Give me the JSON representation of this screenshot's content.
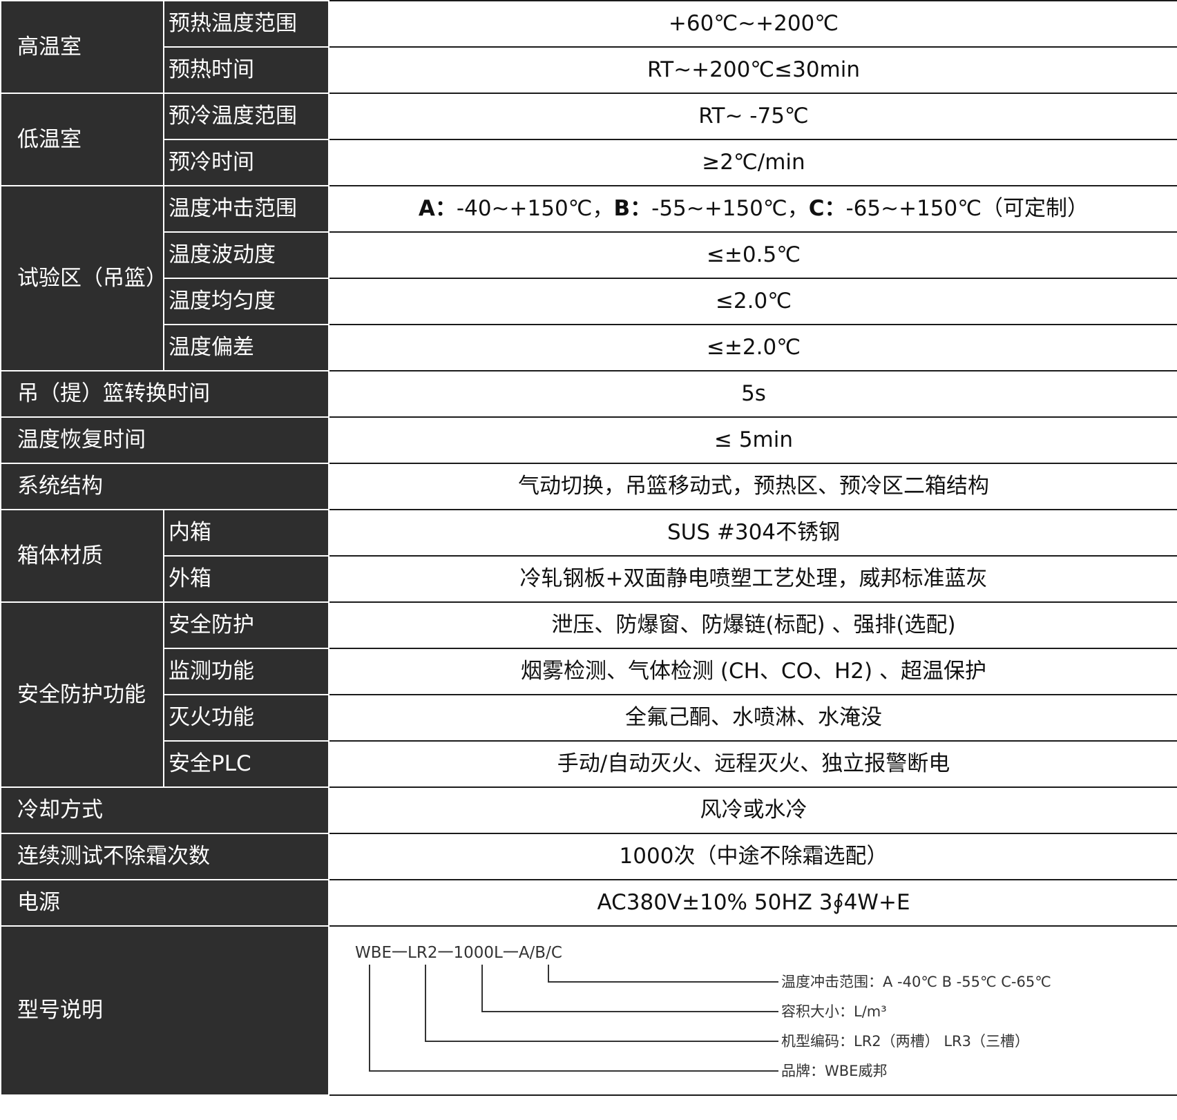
{
  "rows": {
    "high_temp": {
      "header": "高温室",
      "preheat_range": {
        "label": "预热温度范围",
        "value": "+60℃~+200℃"
      },
      "preheat_time": {
        "label": "预热时间",
        "value": "RT~+200℃≤30min"
      }
    },
    "low_temp": {
      "header": "低温室",
      "precool_range": {
        "label": "预冷温度范围",
        "value": "RT~ -75℃"
      },
      "precool_time": {
        "label": "预冷时间",
        "value": "≥2℃/min"
      }
    },
    "test_zone": {
      "header": "试验区（吊篮）",
      "shock_range": {
        "label": "温度冲击范围",
        "a_key": "A：",
        "a_val": "-40~+150℃，",
        "b_key": "B：",
        "b_val": "-55~+150℃，",
        "c_key": "C：",
        "c_val": "-65~+150℃（可定制）"
      },
      "fluctuation": {
        "label": "温度波动度",
        "value": "≤±0.5℃"
      },
      "uniformity": {
        "label": "温度均匀度",
        "value": "≤2.0℃"
      },
      "deviation": {
        "label": "温度偏差",
        "value": "≤±2.0℃"
      }
    },
    "basket_switch": {
      "header": "吊（提）篮转换时间",
      "value": "5s"
    },
    "recovery": {
      "header": "温度恢复时间",
      "value": "≤ 5min"
    },
    "structure": {
      "header": "系统结构",
      "value": "气动切换，吊篮移动式，预热区、预冷区二箱结构"
    },
    "material": {
      "header": "箱体材质",
      "inner": {
        "label": "内箱",
        "value": "SUS #304不锈钢"
      },
      "outer": {
        "label": "外箱",
        "value": "冷轧钢板+双面静电喷塑工艺处理，威邦标准蓝灰"
      }
    },
    "safety": {
      "header": "安全防护功能",
      "protection": {
        "label": "安全防护",
        "value": "泄压、防爆窗、防爆链(标配) 、强排(选配)"
      },
      "monitoring": {
        "label": "监测功能",
        "value": "烟雾检测、气体检测 (CH、CO、H2) 、超温保护"
      },
      "extinguish": {
        "label": "灭火功能",
        "value": "全氟己酮、水喷淋、水淹没"
      },
      "plc": {
        "label": "安全PLC",
        "value": "手动/自动灭火、远程灭火、独立报警断电"
      }
    },
    "cooling": {
      "header": "冷却方式",
      "value": "风冷或水冷"
    },
    "cycles": {
      "header": "连续测试不除霜次数",
      "value": "1000次（中途不除霜选配）"
    },
    "power": {
      "header": "电源",
      "value": "AC380V±10% 50HZ 3∮4W+E"
    },
    "model": {
      "header": "型号说明",
      "code": "WBE一LR2一1000L一A/B/C",
      "notes": {
        "range": "温度冲击范围：A -40℃  B -55℃  C-65℃",
        "volume": "容积大小：L/m³",
        "machine": "机型编码：LR2（两槽） LR3（三槽）",
        "brand": "品牌：WBE威邦"
      }
    }
  }
}
